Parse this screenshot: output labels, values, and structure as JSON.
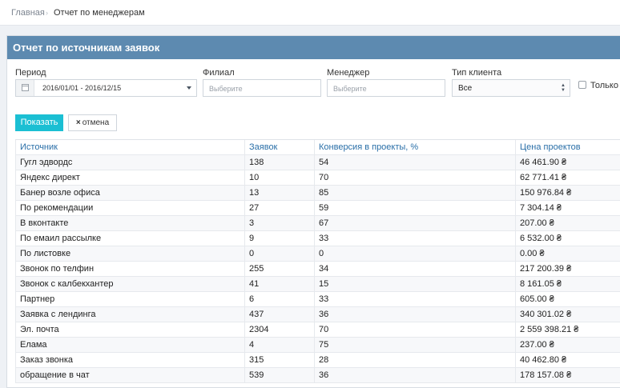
{
  "breadcrumb": {
    "home": "Главная",
    "separator": "›",
    "current": "Отчет по менеджерам"
  },
  "panel": {
    "title": "Отчет по источникам заявок"
  },
  "filters": {
    "period": {
      "label": "Период",
      "value": "2016/01/01 - 2016/12/15",
      "icon": "calendar-icon"
    },
    "branch": {
      "label": "Филиал",
      "placeholder": "Выберите"
    },
    "manager": {
      "label": "Менеджер",
      "placeholder": "Выберите"
    },
    "client_type": {
      "label": "Тип клиента",
      "value": "Все"
    },
    "only_checkbox": {
      "label": "Только с",
      "checked": false
    }
  },
  "buttons": {
    "show": "Показать",
    "cancel_icon": "×",
    "cancel": "отмена"
  },
  "table": {
    "columns": [
      "Источник",
      "Заявок",
      "Конверсия в проекты, %",
      "Цена проектов"
    ],
    "rows": [
      [
        "Гугл эдвордс",
        "138",
        "54",
        "46 461.90 ₴"
      ],
      [
        "Яндекс директ",
        "10",
        "70",
        "62 771.41 ₴"
      ],
      [
        "Банер возле офиса",
        "13",
        "85",
        "150 976.84 ₴"
      ],
      [
        "По рекомендации",
        "27",
        "59",
        "7 304.14 ₴"
      ],
      [
        "В вконтакте",
        "3",
        "67",
        "207.00 ₴"
      ],
      [
        "По емаил рассылке",
        "9",
        "33",
        "6 532.00 ₴"
      ],
      [
        "По листовке",
        "0",
        "0",
        "0.00 ₴"
      ],
      [
        "Звонок по телфин",
        "255",
        "34",
        "217 200.39 ₴"
      ],
      [
        "Звонок с калбекхантер",
        "41",
        "15",
        "8 161.05 ₴"
      ],
      [
        "Партнер",
        "6",
        "33",
        "605.00 ₴"
      ],
      [
        "Заявка с лендинга",
        "437",
        "36",
        "340 301.02 ₴"
      ],
      [
        "Эл. почта",
        "2304",
        "70",
        "2 559 398.21 ₴"
      ],
      [
        "Елама",
        "4",
        "75",
        "237.00 ₴"
      ],
      [
        "Заказ звонка",
        "315",
        "28",
        "40 462.80 ₴"
      ],
      [
        "обращение в чат",
        "539",
        "36",
        "178 157.08 ₴"
      ]
    ]
  },
  "colors": {
    "header": "#5d8ab0",
    "accent": "#1bbfd3",
    "link": "#2a6fa8"
  }
}
